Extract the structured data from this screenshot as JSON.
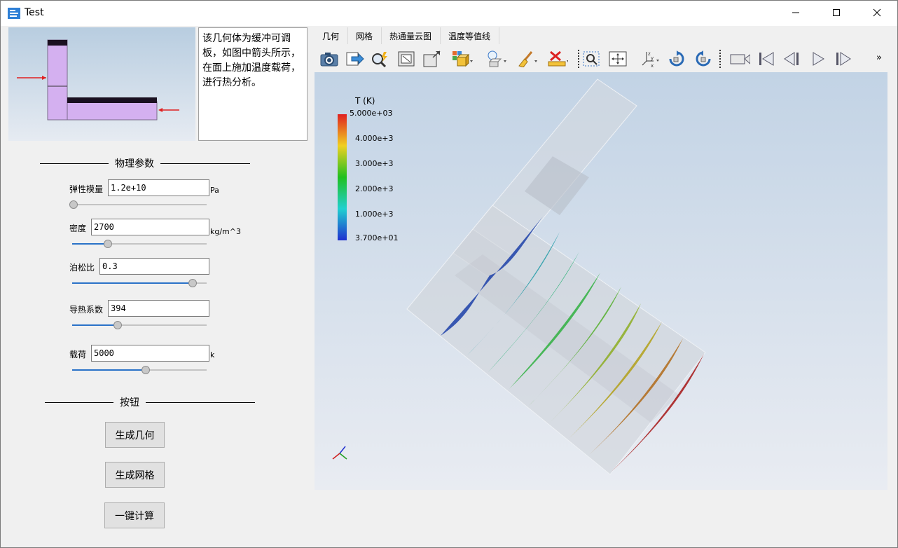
{
  "window": {
    "title": "Test"
  },
  "description": "该几何体为缓冲可调板，如图中箭头所示，在面上施加温度载荷，进行热分析。",
  "physics_section": {
    "title": "物理参数",
    "params": [
      {
        "label": "弹性模量",
        "value": "1.2e+10",
        "unit": "Pa",
        "slider_fraction": 0.0
      },
      {
        "label": "密度",
        "value": "2700",
        "unit": "kg/m^3",
        "slider_fraction": 0.25
      },
      {
        "label": "泊松比",
        "value": "0.3",
        "unit": "",
        "slider_fraction": 0.92
      },
      {
        "label": "导热系数",
        "value": "394",
        "unit": "",
        "slider_fraction": 0.33
      },
      {
        "label": "载荷",
        "value": "5000",
        "unit": "k",
        "slider_fraction": 0.55
      }
    ]
  },
  "buttons_section": {
    "title": "按钮",
    "buttons": [
      "生成几何",
      "生成网格",
      "一键计算"
    ]
  },
  "tabs": [
    "几何",
    "网格",
    "热通量云图",
    "温度等值线"
  ],
  "toolbar_icons": [
    "camera-icon",
    "export-icon",
    "magic-search-icon",
    "fit-view-icon",
    "expand-view-icon",
    "display-mode-icon",
    "light-icon",
    "clean-icon",
    "delete-icon",
    "zoom-box-icon",
    "pan-icon",
    "axes-icon",
    "rotate-cw-icon",
    "rotate-ccw-icon",
    "video-camera-icon",
    "first-frame-icon",
    "prev-frame-icon",
    "play-icon",
    "next-frame-icon",
    "more-icon"
  ],
  "legend": {
    "title": "T (K)",
    "ticks": [
      "5.000e+03",
      "4.000e+3",
      "3.000e+3",
      "2.000e+3",
      "1.000e+3",
      "3.700e+01"
    ],
    "colors": [
      "#e02020",
      "#f0d020",
      "#20c020",
      "#20d0d0",
      "#2030d0"
    ]
  },
  "more_label": "»"
}
